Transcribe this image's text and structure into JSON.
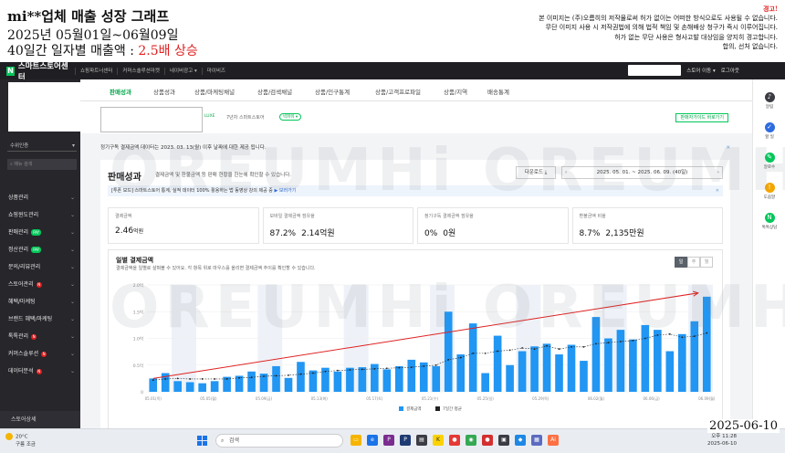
{
  "overlay": {
    "title": "mi**업체 매출 성장 그래프",
    "subtitle": "2025년 05월01일~06월09일",
    "line2_prefix": "40일간 일자별 매출액 : ",
    "line2_highlight": "2.5배 상승",
    "warning_title": "경고!",
    "warning_lines": [
      "본 이미지는 (주)오름히의 저작물로써 허가 없이는 어떠한 방식으로도 사용될 수 없습니다.",
      "무단 이미지 사용 시 저작권법에 의해 법적 책임 및 손해배상 청구가 즉시 이루어집니다.",
      "허가 없는 무단 사용은 형사고발 대상임을 양지히 경고합니다.",
      "합의, 선처 없습니다."
    ],
    "watermark": "OREUMHi OREUMHi",
    "capture_date": "2025-06-10"
  },
  "topbar": {
    "brand_letter": "N",
    "brand_name": "스마트스토어센터",
    "nav": [
      "쇼핑파트너센터",
      "커머스솔루션마켓",
      "네이버광고 ▾",
      "마이비즈"
    ],
    "store_move": "스토어 이동 ▾",
    "logout": "로그아웃"
  },
  "sidebar": {
    "select_label": "수위인증",
    "search_placeholder": "메뉴 검색",
    "items": [
      {
        "label": "상품관리",
        "badge": ""
      },
      {
        "label": "쇼핑윈도관리",
        "badge": ""
      },
      {
        "label": "판매관리",
        "badge": "PAY"
      },
      {
        "label": "정산관리",
        "badge": "PAY"
      },
      {
        "label": "문의/리뷰관리",
        "badge": ""
      },
      {
        "label": "스토어관리",
        "badge": "N"
      },
      {
        "label": "혜택/마케팅",
        "badge": ""
      },
      {
        "label": "브랜드 혜택/마케팅",
        "badge": ""
      },
      {
        "label": "톡톡관리",
        "badge": "N"
      },
      {
        "label": "커머스솔루션",
        "badge": "N"
      },
      {
        "label": "데이터분석",
        "badge": "N"
      }
    ],
    "store_home": "스토어상세"
  },
  "tabs": [
    "판매성과",
    "상품성과",
    "상품/마케팅채널",
    "상품/검색채널",
    "상품/인구통계",
    "상품/고객프로파일",
    "상품/지역",
    "배송통계"
  ],
  "shop": {
    "tag": "LUXE",
    "meta": "7년차  스마트스토어",
    "pill": "빅파워 ▾",
    "cta": "판매자가이드 바로가기"
  },
  "notice": "정기구독 결제금액 데이터는 2023. 03. 13(월) 이후 날짜에 대한 제공 됩니다.",
  "panel": {
    "title": "판매성과",
    "desc": "결제금액 및 환불금액 등 판매 현황을 한눈에 확인할 수 있습니다.",
    "download": "다운로드 ⤓",
    "date_range": "2025. 05. 01. ~ 2025. 06. 09. (40일)",
    "promo_text": "[투폰 모드] 스마트스토어 통계, 실적 데이터 100% 활용하는 법 동영상 강의 제공 중",
    "promo_link": "▶ 보러가기"
  },
  "metrics": [
    {
      "label": "결제금액",
      "value": "2.46",
      "unit": "억원",
      "extra": ""
    },
    {
      "label": "모바일 결제금액 점유율",
      "value": "87.2%",
      "unit": "",
      "extra": "2.14억원"
    },
    {
      "label": "정기구독 결제금액 점유율",
      "value": "0%",
      "unit": "",
      "extra": "0원"
    },
    {
      "label": "환불금액 비율",
      "value": "8.7%",
      "unit": "",
      "extra": "2,135만원"
    }
  ],
  "chart_panel": {
    "title": "일별 결제금액",
    "desc": "결제금액을 일별로 살펴볼 수 있어요. 각 항목 위로 마우스를 올리면 결제금액 추이를 확인할 수 있습니다.",
    "seg": [
      "일",
      "주",
      "월"
    ]
  },
  "chart_data": {
    "type": "bar",
    "ylim": [
      0,
      2.0
    ],
    "y_ticks": [
      "2.0억",
      "1.5억",
      "1.0억",
      "0.5억",
      "0"
    ],
    "x_tick_labels": [
      "05.01(목)",
      "05.05(월)",
      "05.09(금)",
      "05.13(화)",
      "05.17(토)",
      "05.21(수)",
      "05.25(일)",
      "05.29(목)",
      "06.02(월)",
      "06.06(금)",
      "06.09(월)"
    ],
    "series": [
      {
        "name": "결제금액",
        "values": [
          0.25,
          0.35,
          0.2,
          0.18,
          0.16,
          0.2,
          0.28,
          0.3,
          0.38,
          0.34,
          0.48,
          0.26,
          0.56,
          0.4,
          0.45,
          0.38,
          0.45,
          0.46,
          0.52,
          0.42,
          0.48,
          0.6,
          0.55,
          0.48,
          1.5,
          0.7,
          1.28,
          0.35,
          1.05,
          0.5,
          0.76,
          0.85,
          0.9,
          0.7,
          0.88,
          0.58,
          1.4,
          1.0,
          1.16,
          0.98,
          1.25,
          1.16,
          0.76,
          1.08,
          1.32,
          1.78
        ]
      },
      {
        "name": "7일간 평균",
        "values": [
          0.22,
          0.24,
          0.25,
          0.24,
          0.24,
          0.24,
          0.24,
          0.26,
          0.27,
          0.29,
          0.3,
          0.31,
          0.33,
          0.35,
          0.38,
          0.4,
          0.41,
          0.42,
          0.43,
          0.44,
          0.45,
          0.46,
          0.48,
          0.5,
          0.6,
          0.64,
          0.72,
          0.72,
          0.76,
          0.78,
          0.82,
          0.8,
          0.86,
          0.8,
          0.84,
          0.84,
          0.9,
          0.92,
          0.94,
          0.96,
          1.0,
          1.06,
          1.08,
          1.02,
          1.04,
          1.1
        ]
      }
    ],
    "trend_arrow": {
      "from": 0.25,
      "to": 1.85
    },
    "colors": {
      "bar": "#2196f3",
      "avg": "#222222",
      "trend": "#e02020"
    }
  },
  "rail": [
    {
      "label": "알림",
      "color": "#3c3c44",
      "icon": "bell-icon"
    },
    {
      "label": "할 일",
      "color": "#2d6cdf",
      "icon": "check-icon"
    },
    {
      "label": "알로수",
      "color": "#03c75a",
      "icon": "chat-icon"
    },
    {
      "label": "도움말",
      "color": "#f5a500",
      "icon": "help-icon"
    },
    {
      "label": "톡톡상담",
      "color": "#03c75a",
      "icon": "talk-icon"
    }
  ],
  "taskbar": {
    "weather_temp": "20°C",
    "weather_desc": "구름 조금",
    "search_placeholder": "검색",
    "time": "오후 11:28",
    "date": "2025-06-10"
  }
}
